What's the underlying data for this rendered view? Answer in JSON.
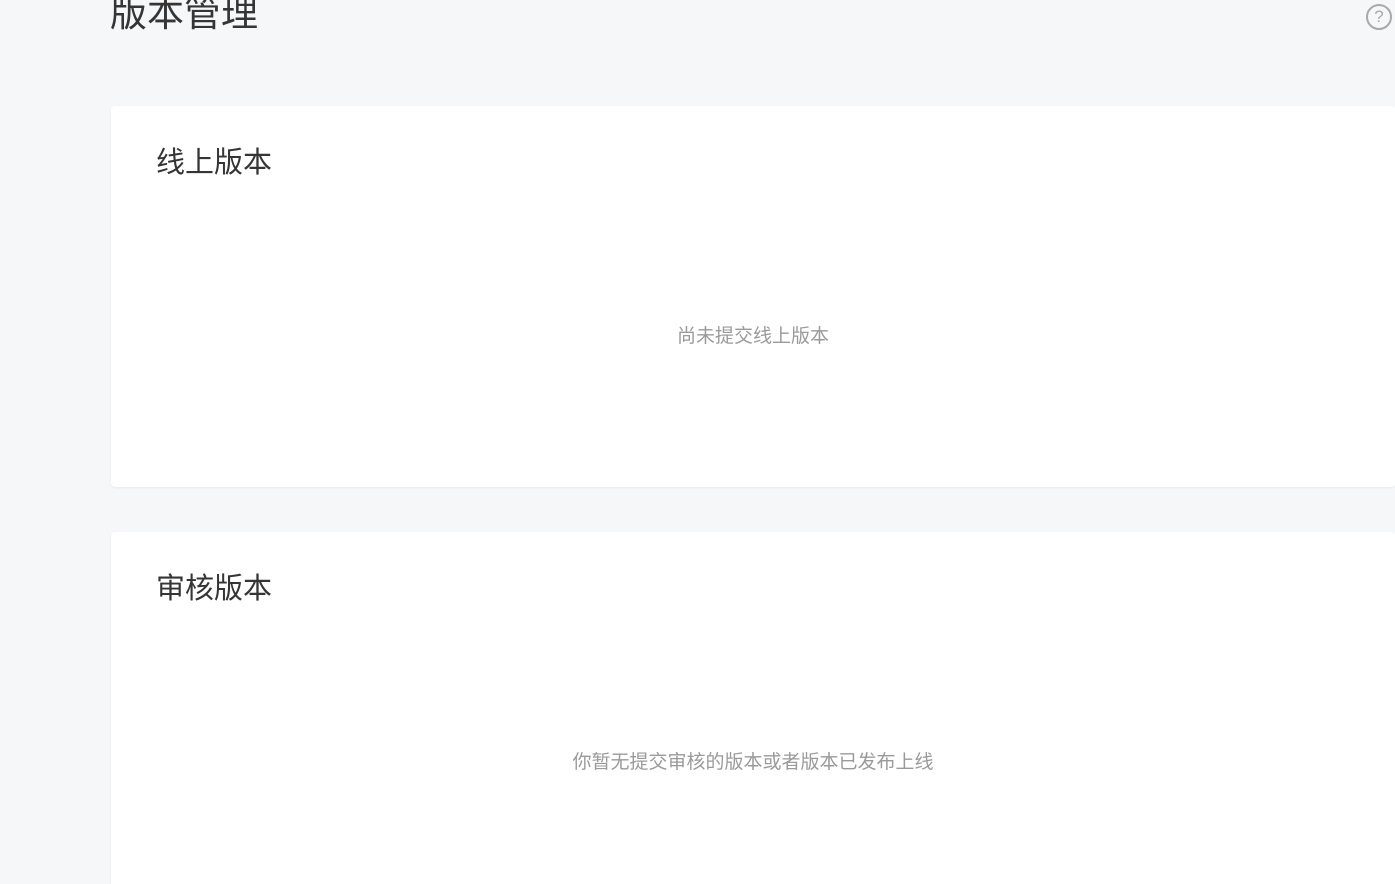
{
  "header": {
    "title": "版本管理",
    "help_icon": "question-circle-icon",
    "help_glyph": "?"
  },
  "sections": {
    "online": {
      "title": "线上版本",
      "empty_text": "尚未提交线上版本"
    },
    "review": {
      "title": "审核版本",
      "empty_text": "你暂无提交审核的版本或者版本已发布上线"
    }
  },
  "colors": {
    "background": "#f6f7f9",
    "card": "#ffffff",
    "title_text": "#353535",
    "muted_text": "#9a9a9a",
    "icon": "#a9a9a9"
  }
}
